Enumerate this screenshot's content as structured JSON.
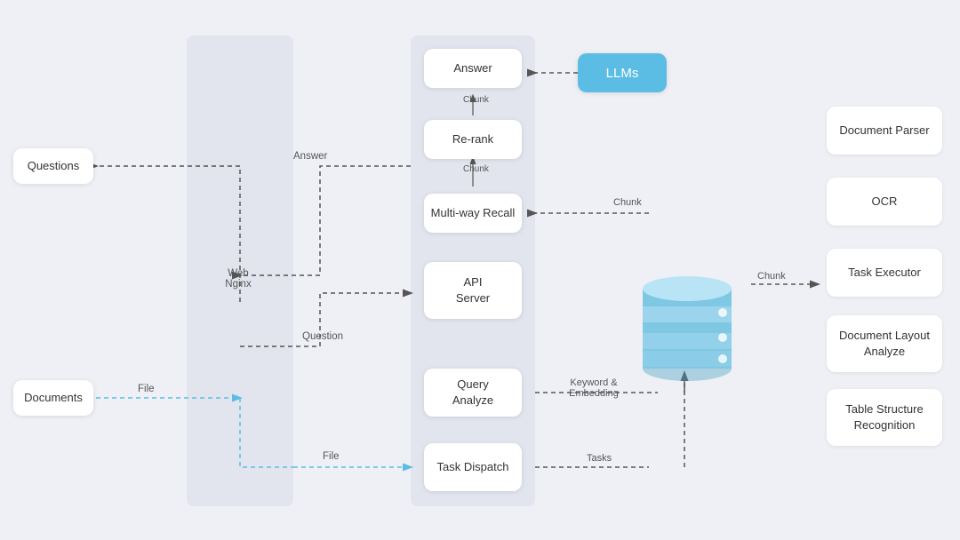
{
  "boxes": {
    "questions": {
      "label": "Questions"
    },
    "documents": {
      "label": "Documents"
    },
    "web_nginx": {
      "label": "Web\nNginx"
    },
    "answer_box": {
      "label": "Answer"
    },
    "rerank": {
      "label": "Re-rank"
    },
    "multiway": {
      "label": "Multi-way Recall"
    },
    "api_server": {
      "label": "API\nServer"
    },
    "query_analyze": {
      "label": "Query\nAnalyze"
    },
    "task_dispatch": {
      "label": "Task Dispatch"
    },
    "llms": {
      "label": "LLMs"
    },
    "doc_parser": {
      "label": "Document Parser"
    },
    "ocr": {
      "label": "OCR"
    },
    "task_executor": {
      "label": "Task Executor"
    },
    "doc_layout": {
      "label": "Document Layout\nAnalyze"
    },
    "table_struct": {
      "label": "Table Structure\nRecognition"
    }
  },
  "labels": {
    "answer1": "Answer",
    "answer2": "Answer",
    "file1": "File",
    "file2": "File",
    "question": "Question",
    "chunk1": "Chunk",
    "chunk2": "Chunk",
    "chunk3": "Chunk",
    "chunk4": "Chunk",
    "keyword_embedding": "Keyword &\nEmbedding",
    "tasks": "Tasks"
  },
  "colors": {
    "blue_box": "#5bbce4",
    "dashed_blue": "#5bbce4",
    "dashed_black": "#666",
    "arrow_black": "#555",
    "db_top": "#a8d8f0",
    "db_mid": "#7ec8e3",
    "db_bot": "#5ab4d6"
  }
}
